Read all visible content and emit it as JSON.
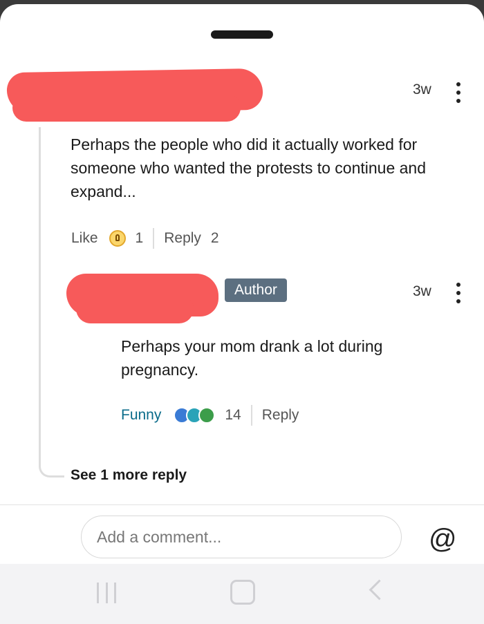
{
  "comment1": {
    "time": "3w",
    "text": "Perhaps the people who did it actually worked for someone who wanted the protests to continue and expand...",
    "like_label": "Like",
    "reaction_count": "1",
    "reply_label": "Reply",
    "reply_count": "2",
    "reaction_icon": "lightbulb-icon"
  },
  "comment2": {
    "badge": "Author",
    "time": "3w",
    "text": "Perhaps your mom drank a lot during pregnancy.",
    "reaction_label": "Funny",
    "reaction_count": "14",
    "reply_label": "Reply",
    "reaction_icons": [
      "thumbs-up-icon",
      "laugh-icon",
      "clap-icon"
    ]
  },
  "see_more": "See 1 more reply",
  "composer": {
    "placeholder": "Add a comment...",
    "mention_icon": "@"
  },
  "colors": {
    "redaction": "#f75a5a",
    "author_badge": "#5c6f80",
    "funny": "#0a6b8a"
  }
}
